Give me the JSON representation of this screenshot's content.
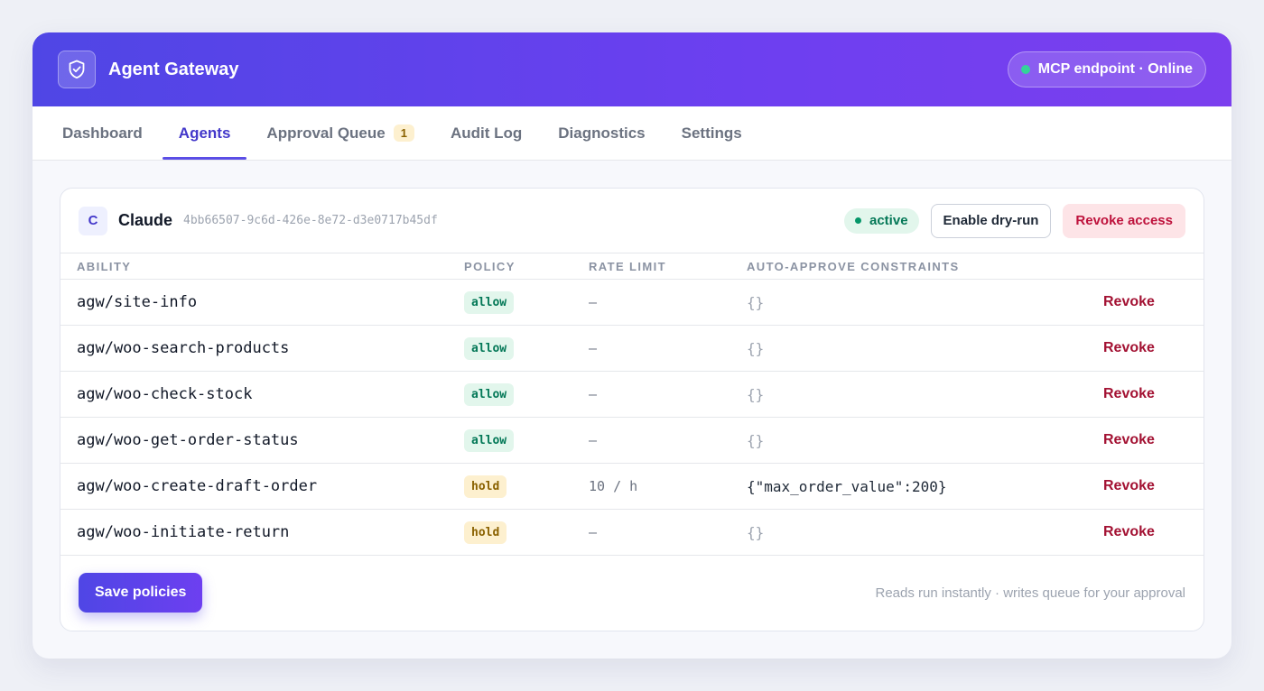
{
  "header": {
    "title": "Agent Gateway",
    "logo_icon": "shield-check-icon",
    "status": "MCP endpoint · Online",
    "status_color": "#34d399"
  },
  "tabs": [
    {
      "label": "Dashboard"
    },
    {
      "label": "Agents",
      "active": true
    },
    {
      "label": "Approval Queue",
      "badge": "1"
    },
    {
      "label": "Audit Log"
    },
    {
      "label": "Diagnostics"
    },
    {
      "label": "Settings"
    }
  ],
  "agent": {
    "initial": "C",
    "name": "Claude",
    "id": "4bb66507-9c6d-426e-8e72-d3e0717b45df",
    "status": "active",
    "dry_run_label": "Enable dry-run",
    "revoke_access_label": "Revoke access"
  },
  "table": {
    "headers": {
      "ability": "ABILITY",
      "policy": "POLICY",
      "rate_limit": "RATE LIMIT",
      "constraints": "AUTO-APPROVE CONSTRAINTS"
    },
    "rows": [
      {
        "ability": "agw/site-info",
        "policy": "allow",
        "rate_limit": "—",
        "constraints": "{}",
        "action": "Revoke"
      },
      {
        "ability": "agw/woo-search-products",
        "policy": "allow",
        "rate_limit": "—",
        "constraints": "{}",
        "action": "Revoke"
      },
      {
        "ability": "agw/woo-check-stock",
        "policy": "allow",
        "rate_limit": "—",
        "constraints": "{}",
        "action": "Revoke"
      },
      {
        "ability": "agw/woo-get-order-status",
        "policy": "allow",
        "rate_limit": "—",
        "constraints": "{}",
        "action": "Revoke"
      },
      {
        "ability": "agw/woo-create-draft-order",
        "policy": "hold",
        "rate_limit": "10 / h",
        "constraints": "{\"max_order_value\":200}",
        "action": "Revoke"
      },
      {
        "ability": "agw/woo-initiate-return",
        "policy": "hold",
        "rate_limit": "—",
        "constraints": "{}",
        "action": "Revoke"
      }
    ]
  },
  "footer": {
    "save_label": "Save policies",
    "note": "Reads run instantly · writes queue for your approval"
  },
  "colors": {
    "accent": "#4f46e5",
    "allow": "#047857",
    "hold": "#8a6100",
    "danger": "#a31233"
  }
}
